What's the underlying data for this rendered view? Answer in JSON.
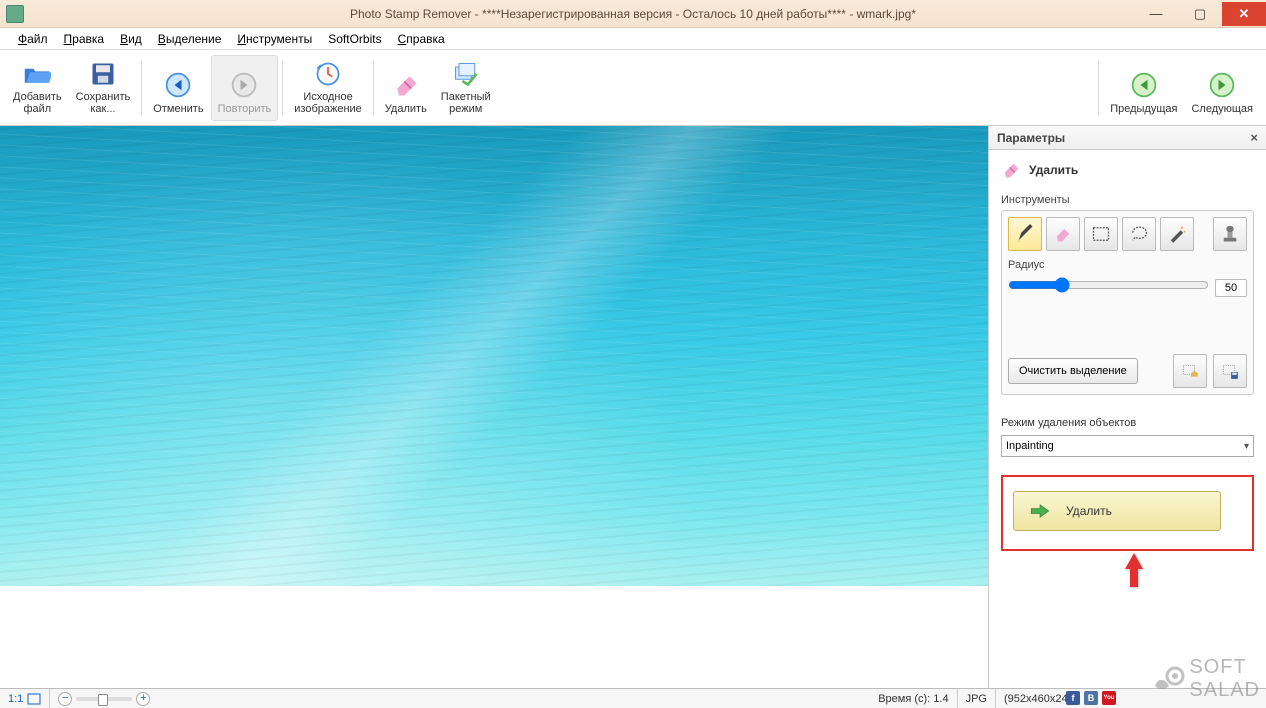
{
  "titlebar": {
    "text": "Photo Stamp Remover - ****Незарегистрированная версия - Осталось 10 дней работы**** - wmark.jpg*"
  },
  "menu": {
    "items": [
      "Файл",
      "Правка",
      "Вид",
      "Выделение",
      "Инструменты",
      "SoftOrbits",
      "Справка"
    ]
  },
  "toolbar": {
    "add_file": "Добавить\nфайл",
    "save_as": "Сохранить\nкак...",
    "undo": "Отменить",
    "redo": "Повторить",
    "original": "Исходное\nизображение",
    "remove": "Удалить",
    "batch": "Пакетный\nрежим",
    "prev": "Предыдущая",
    "next": "Следующая"
  },
  "panel": {
    "header": "Параметры",
    "section": "Удалить",
    "tools_label": "Инструменты",
    "radius_label": "Радиус",
    "radius_value": "50",
    "clear_selection": "Очистить выделение",
    "mode_label": "Режим удаления объектов",
    "mode_value": "Inpainting",
    "big_button": "Удалить"
  },
  "statusbar": {
    "scale": "1:1",
    "time_label": "Время (с): 1.4",
    "format": "JPG",
    "dimensions": "(952x460x24)"
  },
  "watermark": {
    "a": "SOFT",
    "b": "SALAD"
  }
}
